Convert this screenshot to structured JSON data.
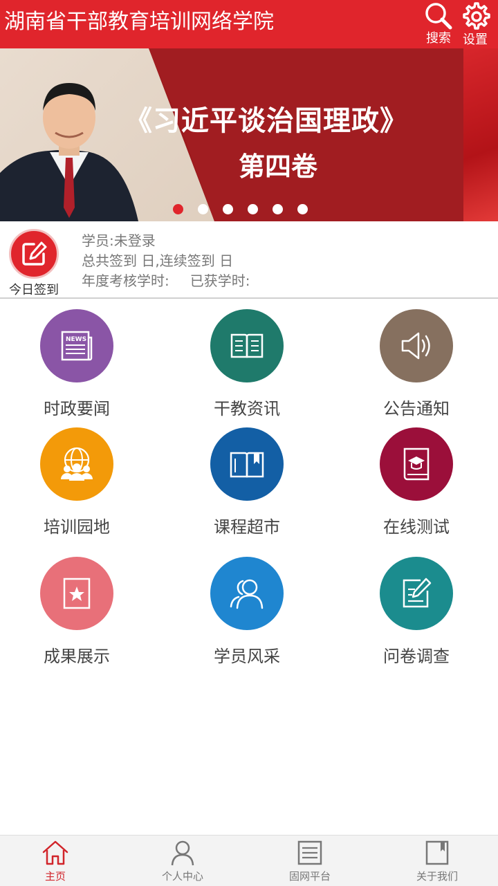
{
  "header": {
    "title": "湖南省干部教育培训网络学院",
    "search_label": "搜索",
    "settings_label": "设置"
  },
  "banner": {
    "title": "《习近平谈治国理政》",
    "subtitle": "第四卷",
    "slide_count": 6,
    "active_slide": 1
  },
  "signin": {
    "button_label": "今日签到",
    "student": "学员:未登录",
    "signin_stats": "总共签到 日,连续签到 日",
    "annual_hours_label": "年度考核学时:",
    "earned_hours_label": "已获学时:"
  },
  "grid": [
    {
      "label": "时政要闻",
      "icon": "newspaper-icon",
      "color": "#8a55a6"
    },
    {
      "label": "干教资讯",
      "icon": "book-open-icon",
      "color": "#1f7a6b"
    },
    {
      "label": "公告通知",
      "icon": "speaker-icon",
      "color": "#86705f"
    },
    {
      "label": "培训园地",
      "icon": "global-people-icon",
      "color": "#f39a09"
    },
    {
      "label": "课程超市",
      "icon": "book-bookmark-icon",
      "color": "#135fa5"
    },
    {
      "label": "在线测试",
      "icon": "exam-book-icon",
      "color": "#9b0f3a"
    },
    {
      "label": "成果展示",
      "icon": "star-frame-icon",
      "color": "#e87079"
    },
    {
      "label": "学员风采",
      "icon": "users-icon",
      "color": "#1f86d0"
    },
    {
      "label": "问卷调查",
      "icon": "edit-note-icon",
      "color": "#1b8c8e"
    }
  ],
  "bottom_nav": [
    {
      "label": "主页",
      "icon": "home-icon",
      "active": true
    },
    {
      "label": "个人中心",
      "icon": "person-icon",
      "active": false
    },
    {
      "label": "固网平台",
      "icon": "list-doc-icon",
      "active": false
    },
    {
      "label": "关于我们",
      "icon": "bookmark-doc-icon",
      "active": false
    }
  ],
  "colors": {
    "brand_red": "#e0252c",
    "nav_active": "#d1242a"
  }
}
